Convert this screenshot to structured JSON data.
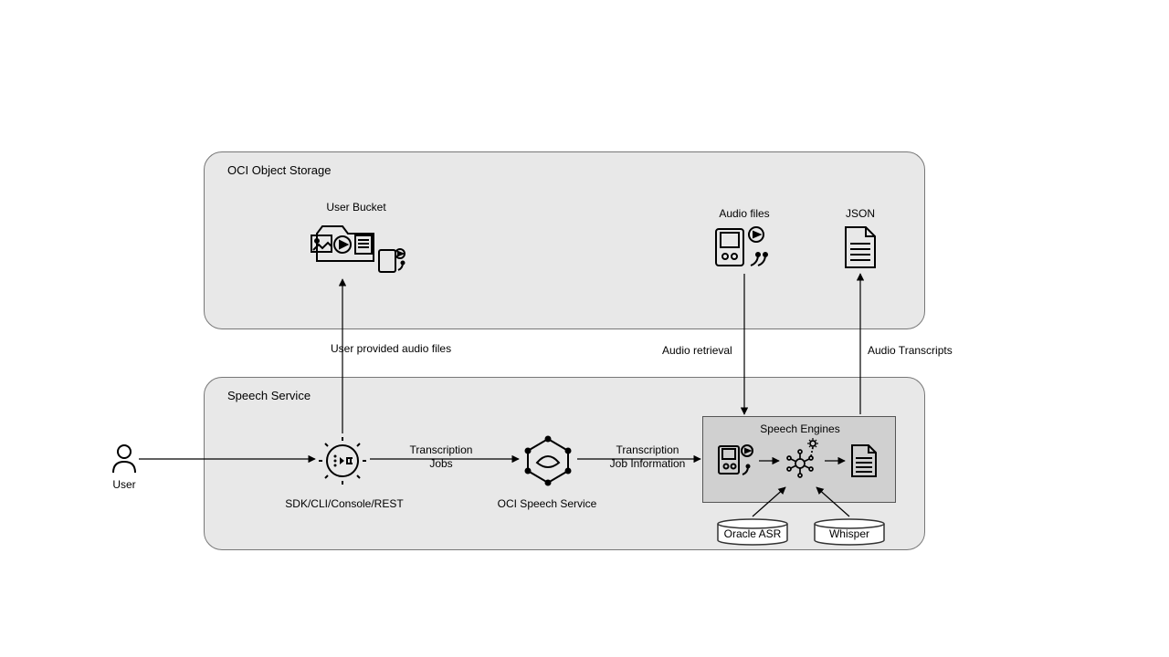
{
  "panels": {
    "storage_title": "OCI Object Storage",
    "service_title": "Speech Service",
    "engines_title": "Speech Engines"
  },
  "labels": {
    "user_bucket": "User Bucket",
    "audio_files": "Audio files",
    "json": "JSON",
    "user": "User",
    "sdk_cli": "SDK/CLI/Console/REST",
    "oci_speech": "OCI Speech Service",
    "oracle_asr": "Oracle ASR",
    "whisper": "Whisper"
  },
  "edges": {
    "user_provided": "User provided audio files",
    "transcription_jobs": "Transcription\nJobs",
    "transcription_info": "Transcription\nJob Information",
    "audio_retrieval": "Audio retrieval",
    "audio_transcripts": "Audio Transcripts"
  }
}
